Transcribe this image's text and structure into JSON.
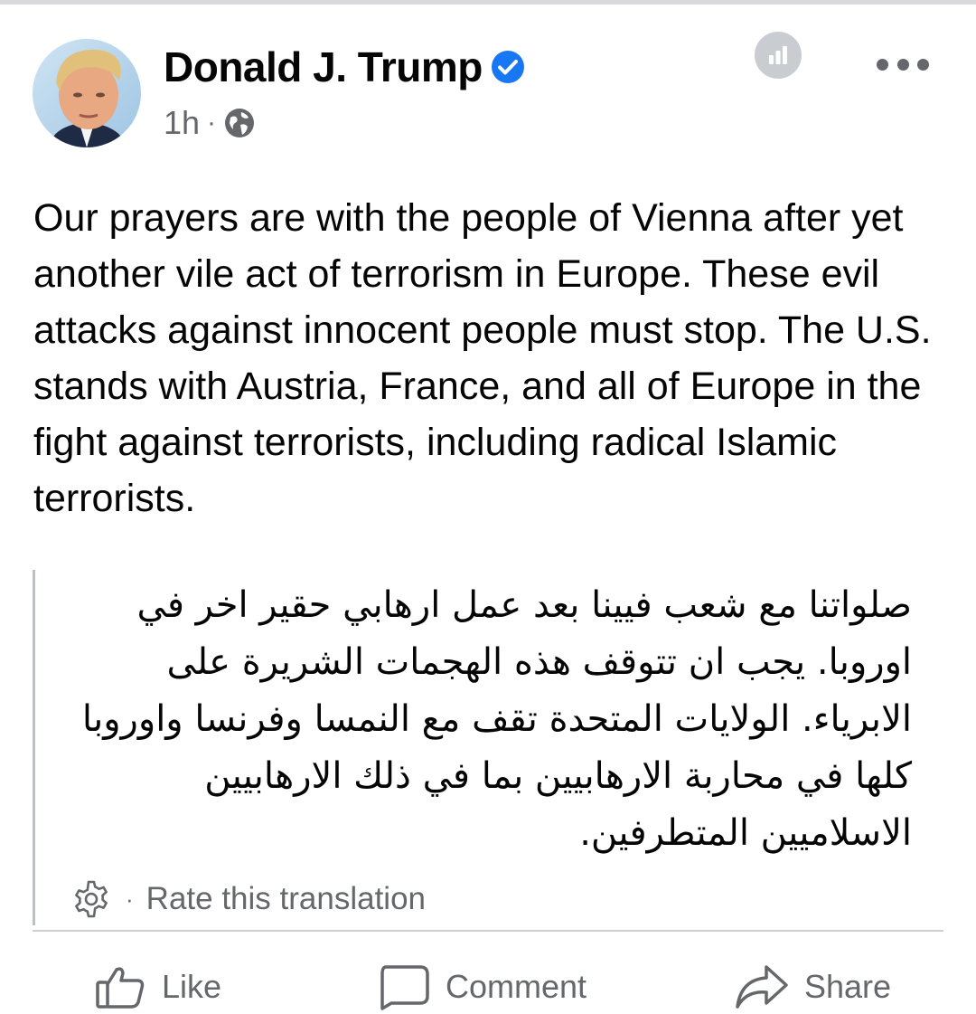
{
  "post": {
    "author": "Donald J. Trump",
    "time": "1h",
    "separator": "·",
    "text": "Our prayers are with the people of Vienna after yet another vile act of terrorism in Europe. These evil attacks against innocent people must stop. The U.S. stands with Austria, France, and all of Europe in the fight against terrorists, including radical Islamic terrorists.",
    "translation": "صلواتنا مع شعب فيينا بعد عمل ارهابي حقير اخر في اوروبا. يجب ان تتوقف هذه الهجمات الشريرة على الابرياء. الولايات المتحدة تقف مع النمسا وفرنسا واوروبا كلها في محاربة الارهابيين بما في ذلك الارهابيين الاسلاميين المتطرفين.",
    "rate_translation": "Rate this translation"
  },
  "actions": {
    "like": "Like",
    "comment": "Comment",
    "share": "Share"
  },
  "colors": {
    "verified_blue": "#1877f2",
    "secondary_text": "#65676b",
    "insights_gray": "#c9ccd1"
  },
  "icons": {
    "audience": "globe-icon",
    "verified": "verified-badge-icon",
    "insights": "bar-chart-icon",
    "more": "more-options-icon",
    "settings": "gear-icon",
    "like": "thumbs-up-icon",
    "comment": "comment-icon",
    "share": "share-arrow-icon"
  }
}
